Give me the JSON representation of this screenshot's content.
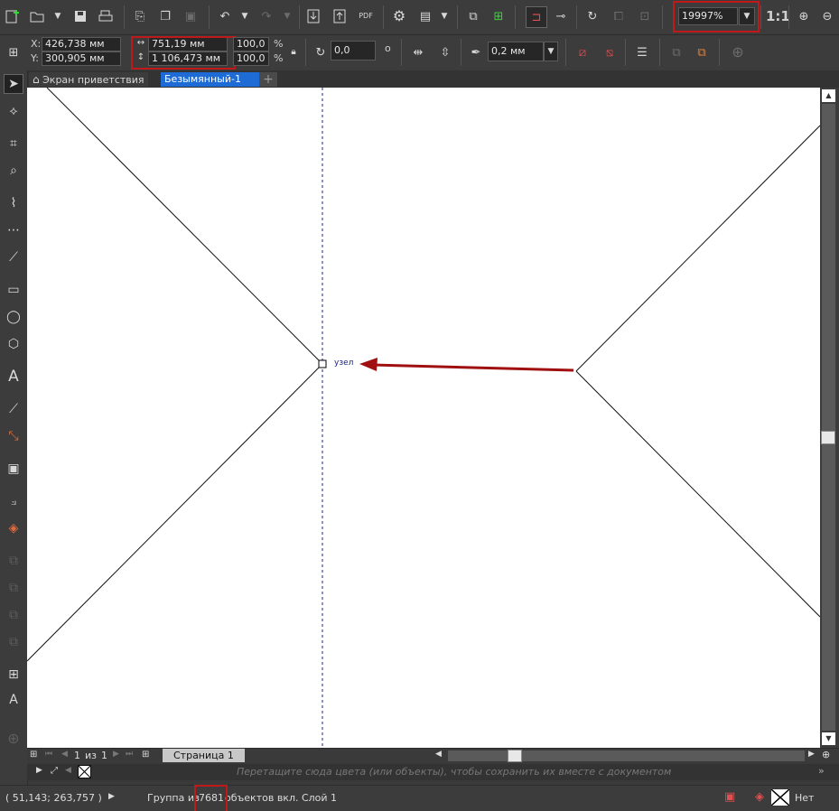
{
  "zoom": {
    "value": "19997%",
    "ratio_label": "1:1"
  },
  "position": {
    "x_label": "X:",
    "x_value": "426,738 мм",
    "y_label": "Y:",
    "y_value": "300,905 мм"
  },
  "size": {
    "width": "751,19 мм",
    "height": "1 106,473 мм"
  },
  "scale": {
    "x": "100,0",
    "y": "100,0",
    "unit": "%"
  },
  "rotation": {
    "value": "0,0",
    "unit": "o"
  },
  "outline": {
    "width": "0,2 мм"
  },
  "tabs": {
    "welcome": "Экран приветствия",
    "document": "Безымянный-1",
    "add": "+"
  },
  "canvas": {
    "node_label": "узел"
  },
  "pagenav": {
    "current": "1",
    "of": "из",
    "total": "1",
    "page_tab": "Страница 1"
  },
  "palette": {
    "hint": "Перетащите сюда цвета (или объекты), чтобы сохранить их вместе с документом"
  },
  "status": {
    "coords": "( 51,143; 263,757 )",
    "selection_prefix": "Группа из",
    "count": "7681",
    "selection_suffix": "объектов вкл. Слой 1",
    "fill_label": "Нет"
  },
  "colors": {
    "highlight": "#c0191b",
    "arrow": "#a01010",
    "active_tab": "#1e6bd6"
  }
}
